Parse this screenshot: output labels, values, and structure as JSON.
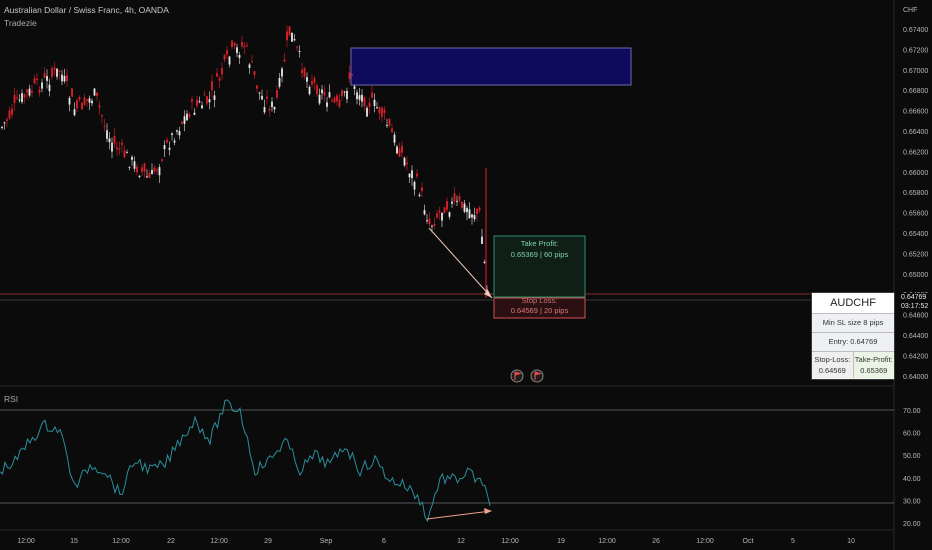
{
  "header": {
    "title": "Australian Dollar / Swiss Franc, 4h, OANDA",
    "subtitle": "Tradezie"
  },
  "price_axis": {
    "currency": "CHF",
    "labels": [
      "0.67400",
      "0.67200",
      "0.67000",
      "0.66800",
      "0.66600",
      "0.66400",
      "0.66200",
      "0.66000",
      "0.65800",
      "0.65600",
      "0.65400",
      "0.65200",
      "0.65000",
      "0.64800",
      "0.64600",
      "0.64400",
      "0.64200",
      "0.64000"
    ],
    "current_price": "0.64769",
    "countdown": "03:17:52"
  },
  "rsi": {
    "label": "RSI",
    "axis_labels": [
      "70.00",
      "60.00",
      "50.00",
      "40.00",
      "30.00",
      "20.00"
    ]
  },
  "time_axis": {
    "labels": [
      "12:00",
      "15",
      "12:00",
      "22",
      "12:00",
      "29",
      "Sep",
      "6",
      "12",
      "12:00",
      "19",
      "12:00",
      "26",
      "12:00",
      "Oct",
      "5",
      "10"
    ]
  },
  "trade": {
    "take_profit_label": "Take Profit:",
    "take_profit_value": "0.65369 | 60 pips",
    "stop_loss_label": "Stop Loss:",
    "stop_loss_value": "0.64569 | 20 pips"
  },
  "info_panel": {
    "symbol": "AUDCHF",
    "min_sl": "Min SL size 8 pips",
    "entry": "Entry: 0.64769",
    "sl_label": "Stop-Loss:",
    "sl_value": "0.64569",
    "tp_label": "Take-Profit:",
    "tp_value": "0.65369"
  },
  "colors": {
    "bull": "#e8e8e8",
    "bear": "#e0202a",
    "supply_zone": "#0e0a5e",
    "take_profit": "#2f8f6a",
    "stop_loss": "#d05050",
    "rsi_line": "#2a8f9a"
  },
  "icons": [
    "flag-icon",
    "flag-icon"
  ]
}
